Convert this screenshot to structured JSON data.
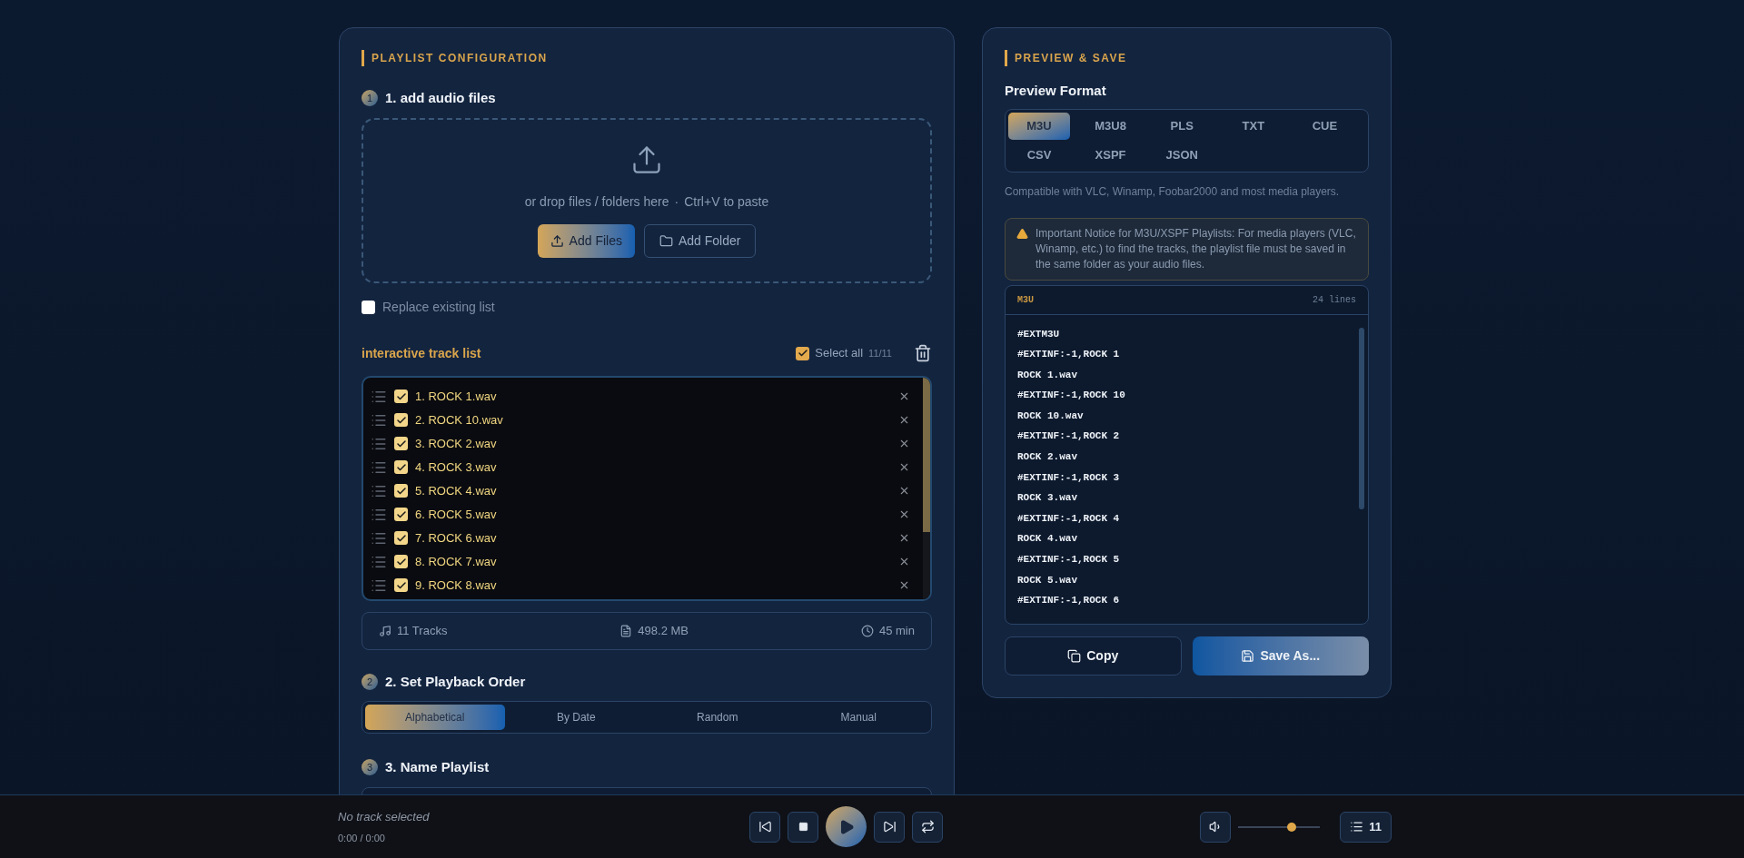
{
  "left_panel": {
    "title": "PLAYLIST CONFIGURATION",
    "step1": {
      "number": "1",
      "title": "1. add audio files",
      "drop_hint": "or drop files / folders here",
      "separator": "·",
      "paste_hint": "Ctrl+V to paste",
      "buttons": [
        {
          "kind": "files",
          "label": "Add Files"
        },
        {
          "kind": "folder",
          "label": "Add Folder"
        }
      ]
    },
    "replace_existing": {
      "label": "Replace existing list",
      "checked": false
    },
    "track_list": {
      "title": "interactive track list",
      "select_all": {
        "label": "Select all",
        "checked": true
      },
      "count": "11/11",
      "tracks": [
        {
          "name": "1. ROCK 1.wav",
          "checked": true
        },
        {
          "name": "2. ROCK 10.wav",
          "checked": true
        },
        {
          "name": "3. ROCK 2.wav",
          "checked": true
        },
        {
          "name": "4. ROCK 3.wav",
          "checked": true
        },
        {
          "name": "5. ROCK 4.wav",
          "checked": true
        },
        {
          "name": "6. ROCK 5.wav",
          "checked": true
        },
        {
          "name": "7. ROCK 6.wav",
          "checked": true
        },
        {
          "name": "8. ROCK 7.wav",
          "checked": true
        },
        {
          "name": "9. ROCK 8.wav",
          "checked": true
        }
      ]
    },
    "stats": [
      {
        "kind": "tracks",
        "text": "11 Tracks"
      },
      {
        "kind": "size",
        "text": "498.2 MB"
      },
      {
        "kind": "duration",
        "text": "45 min"
      }
    ],
    "step2": {
      "number": "2",
      "title": "2. Set Playback Order",
      "options": [
        {
          "label": "Alphabetical",
          "selected": true
        },
        {
          "label": "By Date",
          "selected": false
        },
        {
          "label": "Random",
          "selected": false
        },
        {
          "label": "Manual",
          "selected": false
        }
      ]
    },
    "step3": {
      "number": "3",
      "title": "3. Name Playlist"
    }
  },
  "right_panel": {
    "title": "PREVIEW & SAVE",
    "format_label": "Preview Format",
    "formats": [
      {
        "label": "M3U",
        "selected": true
      },
      {
        "label": "M3U8",
        "selected": false
      },
      {
        "label": "PLS",
        "selected": false
      },
      {
        "label": "TXT",
        "selected": false
      },
      {
        "label": "CUE",
        "selected": false
      },
      {
        "label": "CSV",
        "selected": false
      },
      {
        "label": "XSPF",
        "selected": false
      },
      {
        "label": "JSON",
        "selected": false
      }
    ],
    "compat_note": "Compatible with VLC, Winamp, Foobar2000 and most media players.",
    "notice": "Important Notice for M3U/XSPF Playlists: For media players (VLC, Winamp, etc.) to find the tracks, the playlist file must be saved in the same folder as your audio files.",
    "code": {
      "format": "M3U",
      "line_count": "24 lines",
      "lines": [
        "#EXTM3U",
        "#EXTINF:-1,ROCK 1",
        "ROCK 1.wav",
        "#EXTINF:-1,ROCK 10",
        "ROCK 10.wav",
        "#EXTINF:-1,ROCK 2",
        "ROCK 2.wav",
        "#EXTINF:-1,ROCK 3",
        "ROCK 3.wav",
        "#EXTINF:-1,ROCK 4",
        "ROCK 4.wav",
        "#EXTINF:-1,ROCK 5",
        "ROCK 5.wav",
        "#EXTINF:-1,ROCK 6"
      ]
    },
    "buttons": [
      {
        "kind": "copy",
        "label": "Copy"
      },
      {
        "kind": "save",
        "label": "Save As..."
      }
    ]
  },
  "player": {
    "track": "No track selected",
    "time": "0:00 / 0:00",
    "volume": {
      "level": 0.65
    },
    "queue_count": "11"
  }
}
